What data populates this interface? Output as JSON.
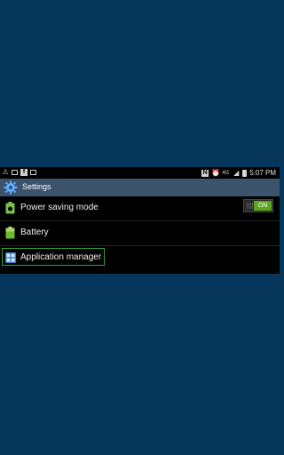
{
  "statusbar": {
    "left_icons": [
      "warning-icon",
      "media-icon",
      "facebook-icon",
      "mail-icon"
    ],
    "right_icons": [
      "nfc-icon",
      "alarm-icon",
      "4g-icon",
      "signal-icon",
      "battery-icon"
    ],
    "time": "5:07 PM"
  },
  "header": {
    "title": "Settings",
    "icon": "settings-gear-icon"
  },
  "rows": [
    {
      "label": "Power saving mode",
      "icon": "power-saving-icon",
      "toggle": "ON"
    },
    {
      "label": "Battery",
      "icon": "battery-icon"
    },
    {
      "label": "Application manager",
      "icon": "application-grid-icon"
    }
  ],
  "colors": {
    "background": "#06365a",
    "header": "#3b536b",
    "toggle_on": "#5aa61c",
    "focus": "#2fa43a"
  }
}
